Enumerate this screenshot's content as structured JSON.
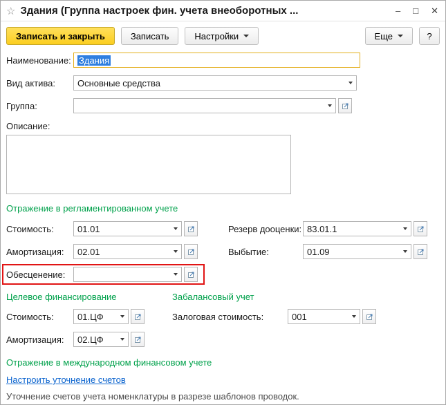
{
  "window": {
    "title": "Здания (Группа настроек фин. учета внеоборотных ...",
    "star": "☆",
    "minimize": "–",
    "maximize": "□",
    "close": "✕"
  },
  "toolbar": {
    "save_close": "Записать и закрыть",
    "save": "Записать",
    "settings": "Настройки",
    "more": "Еще",
    "help": "?"
  },
  "fields": {
    "name": {
      "label": "Наименование:",
      "value": "Здания"
    },
    "asset_type": {
      "label": "Вид актива:",
      "value": "Основные средства"
    },
    "group": {
      "label": "Группа:",
      "value": ""
    },
    "description": {
      "label": "Описание:",
      "value": ""
    }
  },
  "sections": {
    "regulated": {
      "header": "Отражение в регламентированном учете",
      "cost": {
        "label": "Стоимость:",
        "value": "01.01"
      },
      "revaluation_reserve": {
        "label": "Резерв дооценки:",
        "value": "83.01.1"
      },
      "depreciation": {
        "label": "Амортизация:",
        "value": "02.01"
      },
      "disposal": {
        "label": "Выбытие:",
        "value": "01.09"
      },
      "impairment": {
        "label": "Обесценение:",
        "value": ""
      }
    },
    "target_financing": {
      "header": "Целевое финансирование",
      "cost": {
        "label": "Стоимость:",
        "value": "01.ЦФ"
      },
      "depreciation": {
        "label": "Амортизация:",
        "value": "02.ЦФ"
      }
    },
    "off_balance": {
      "header": "Забалансовый учет",
      "pledge_cost": {
        "label": "Залоговая стоимость:",
        "value": "001"
      }
    },
    "international": {
      "header": "Отражение в международном финансовом учете",
      "link": "Настроить уточнение счетов",
      "note": "Уточнение счетов учета номенклатуры в разрезе шаблонов проводок."
    }
  },
  "colors": {
    "header_green": "#00a14b",
    "link_blue": "#0a63ce",
    "accent_yellow": "#ffd42e",
    "accent_yellow_border": "#c7a827",
    "focus_border": "#e3ae1b",
    "selection_blue": "#2f7fe0",
    "highlight_red": "#e11414",
    "field_border": "#b5b5b5",
    "button_border": "#c0c0c0"
  }
}
